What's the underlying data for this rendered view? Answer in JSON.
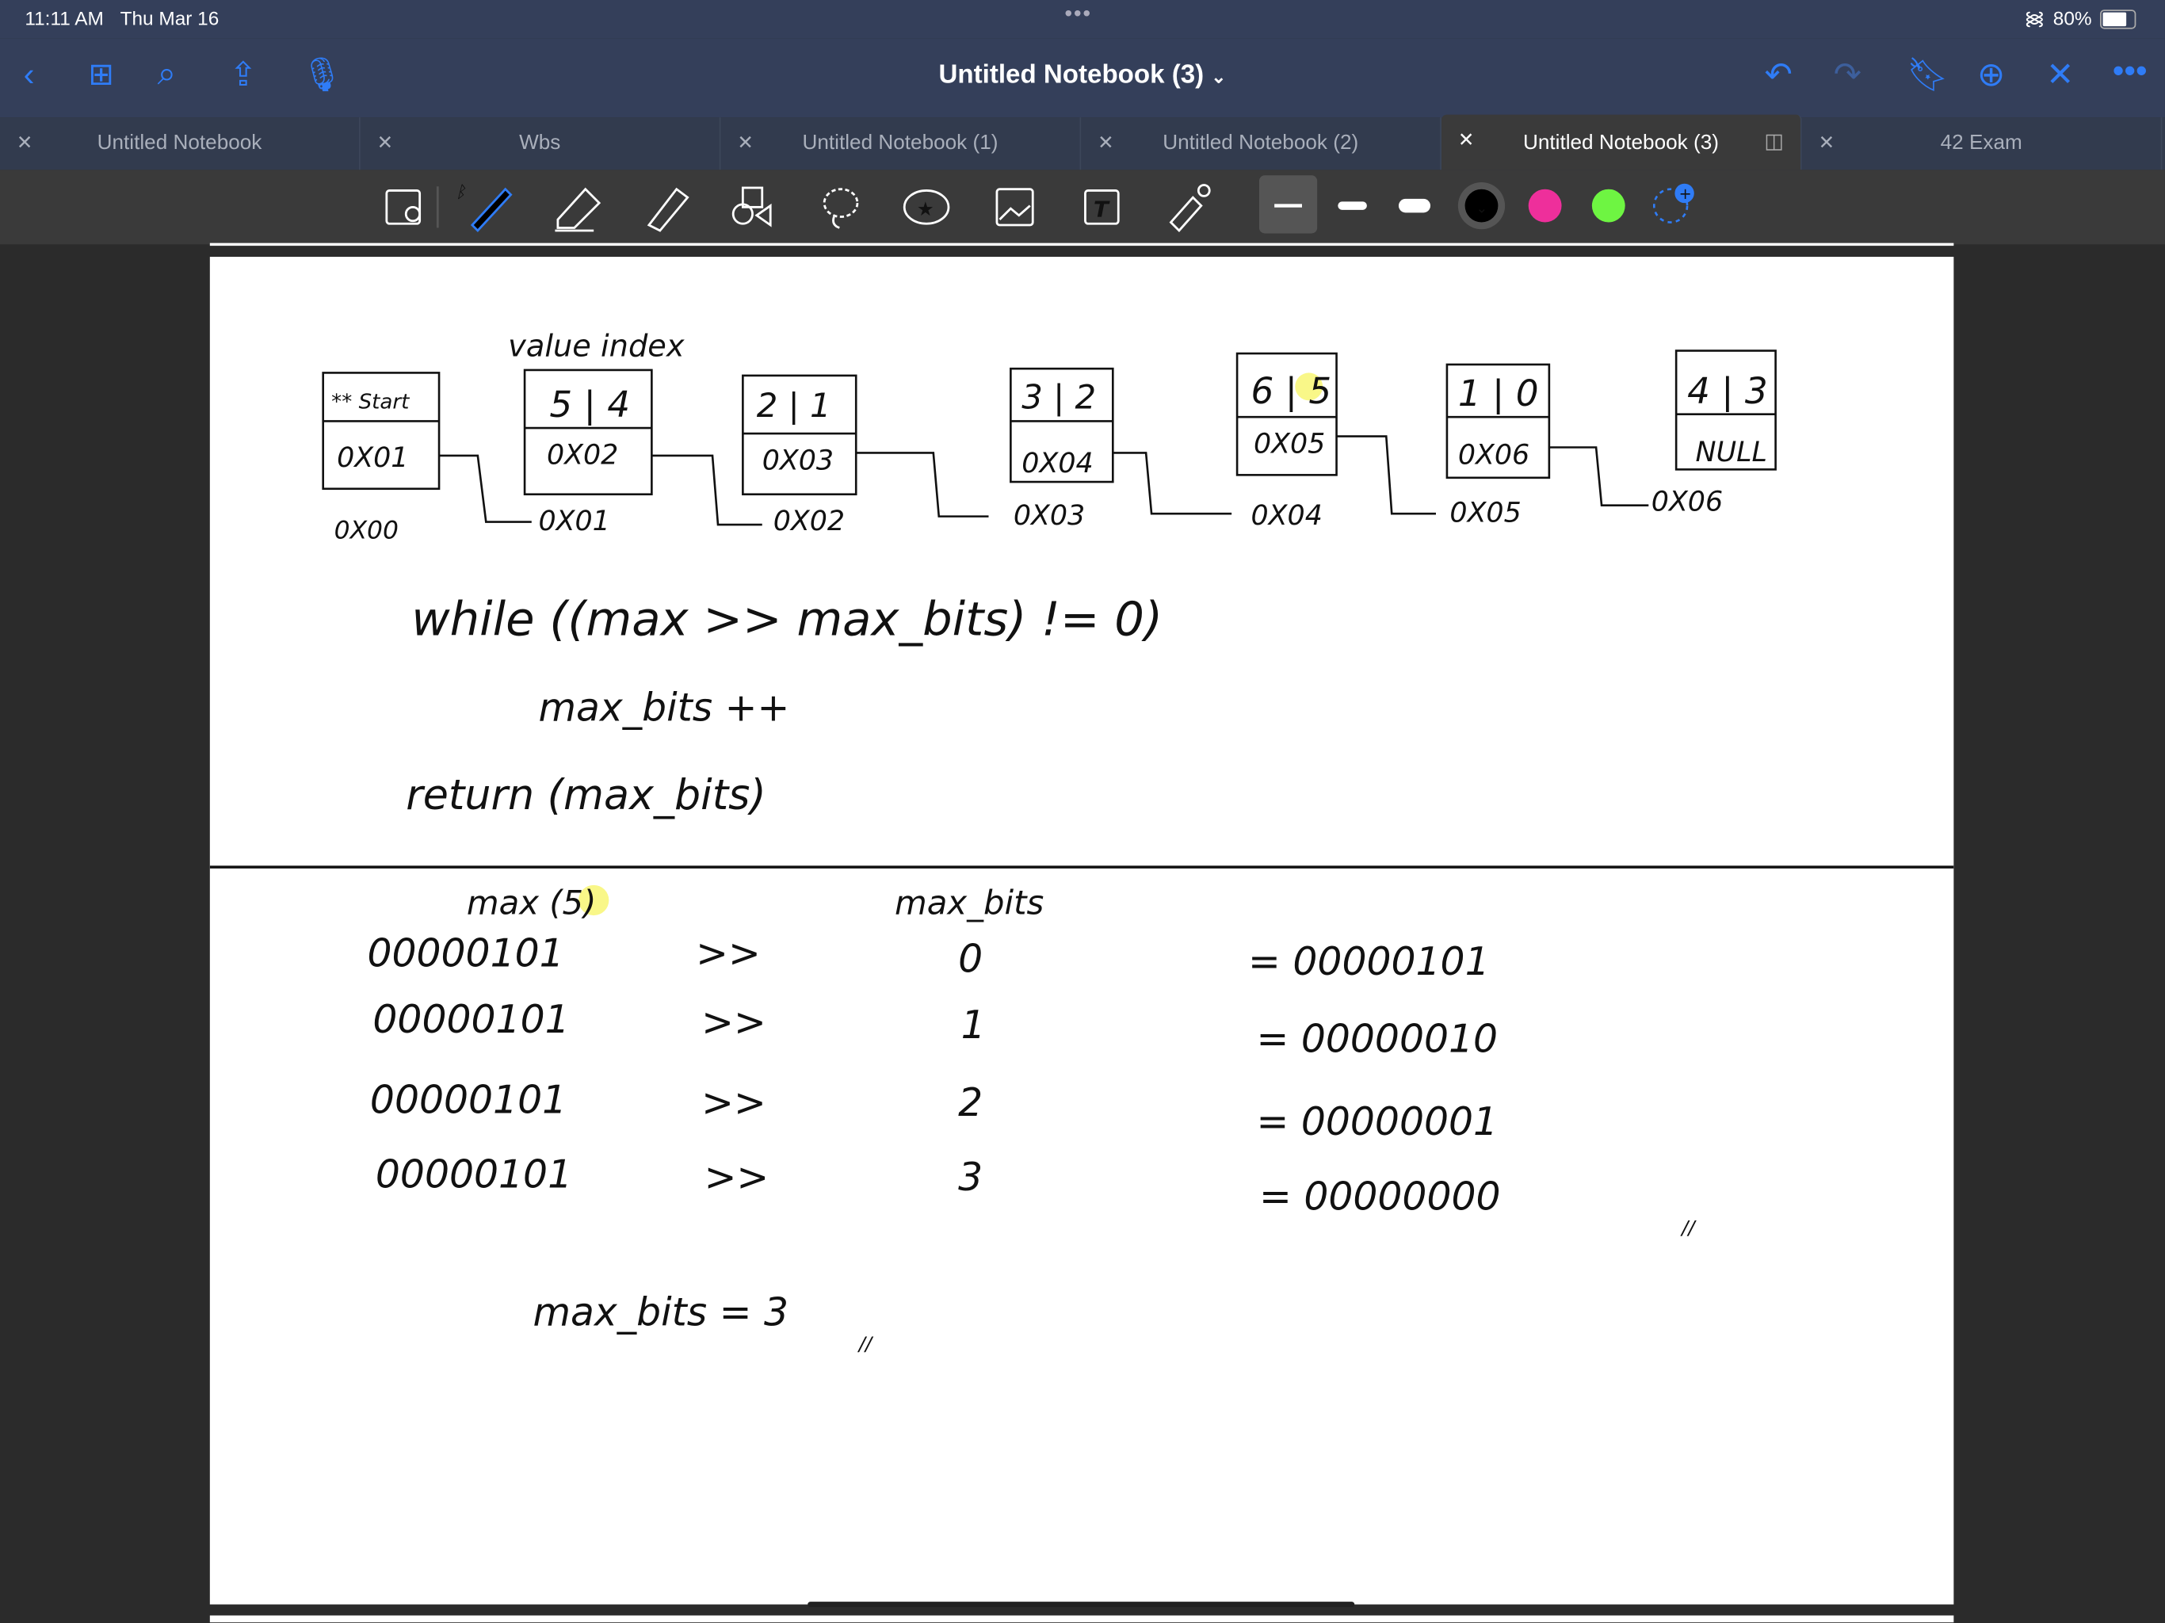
{
  "status": {
    "time": "11:11 AM",
    "date": "Thu Mar 16",
    "battery": "80%",
    "wifi_icon": "wifi-icon"
  },
  "nav": {
    "title": "Untitled Notebook (3)",
    "chevron": "⌄"
  },
  "tabs": [
    {
      "label": "Untitled Notebook",
      "active": false
    },
    {
      "label": "Wbs",
      "active": false
    },
    {
      "label": "Untitled Notebook (1)",
      "active": false
    },
    {
      "label": "Untitled Notebook (2)",
      "active": false
    },
    {
      "label": "Untitled Notebook (3)",
      "active": true
    },
    {
      "label": "42 Exam",
      "active": false
    }
  ],
  "toolbar": {
    "colors": {
      "black": "#000000",
      "pink": "#ee2f9b",
      "green": "#6ef542",
      "accent": "#2f7cf6"
    }
  },
  "notes": {
    "header": "value  index",
    "nodes": [
      {
        "top": "** Start",
        "addr": "0X01",
        "below": "0X00"
      },
      {
        "top": "5 | 4",
        "addr": "0X02",
        "below": "0X01"
      },
      {
        "top": "2 | 1",
        "addr": "0X03",
        "below": "0X02"
      },
      {
        "top": "3 | 2",
        "addr": "0X04",
        "below": "0X03"
      },
      {
        "top": "6 | 5",
        "addr": "0X05",
        "below": "0X04"
      },
      {
        "top": "1 | 0",
        "addr": "0X06",
        "below": "0X05"
      },
      {
        "top": "4 | 3",
        "addr": "NULL",
        "below": "0X06"
      }
    ],
    "code": [
      "while ((max >> max_bits) != 0)",
      "max_bits ++",
      "return (max_bits)"
    ],
    "col_max": "max (5)",
    "col_bits": "max_bits",
    "rows": [
      {
        "bin": "00000101",
        "op": ">>",
        "bits": "0",
        "res": "= 00000101"
      },
      {
        "bin": "00000101",
        "op": ">>",
        "bits": "1",
        "res": "= 00000010"
      },
      {
        "bin": "00000101",
        "op": ">>",
        "bits": "2",
        "res": "= 00000001"
      },
      {
        "bin": "00000101",
        "op": ">>",
        "bits": "3",
        "res": "= 00000000"
      }
    ],
    "result": "max_bits = 3",
    "tick1": "//",
    "tick2": "//"
  }
}
